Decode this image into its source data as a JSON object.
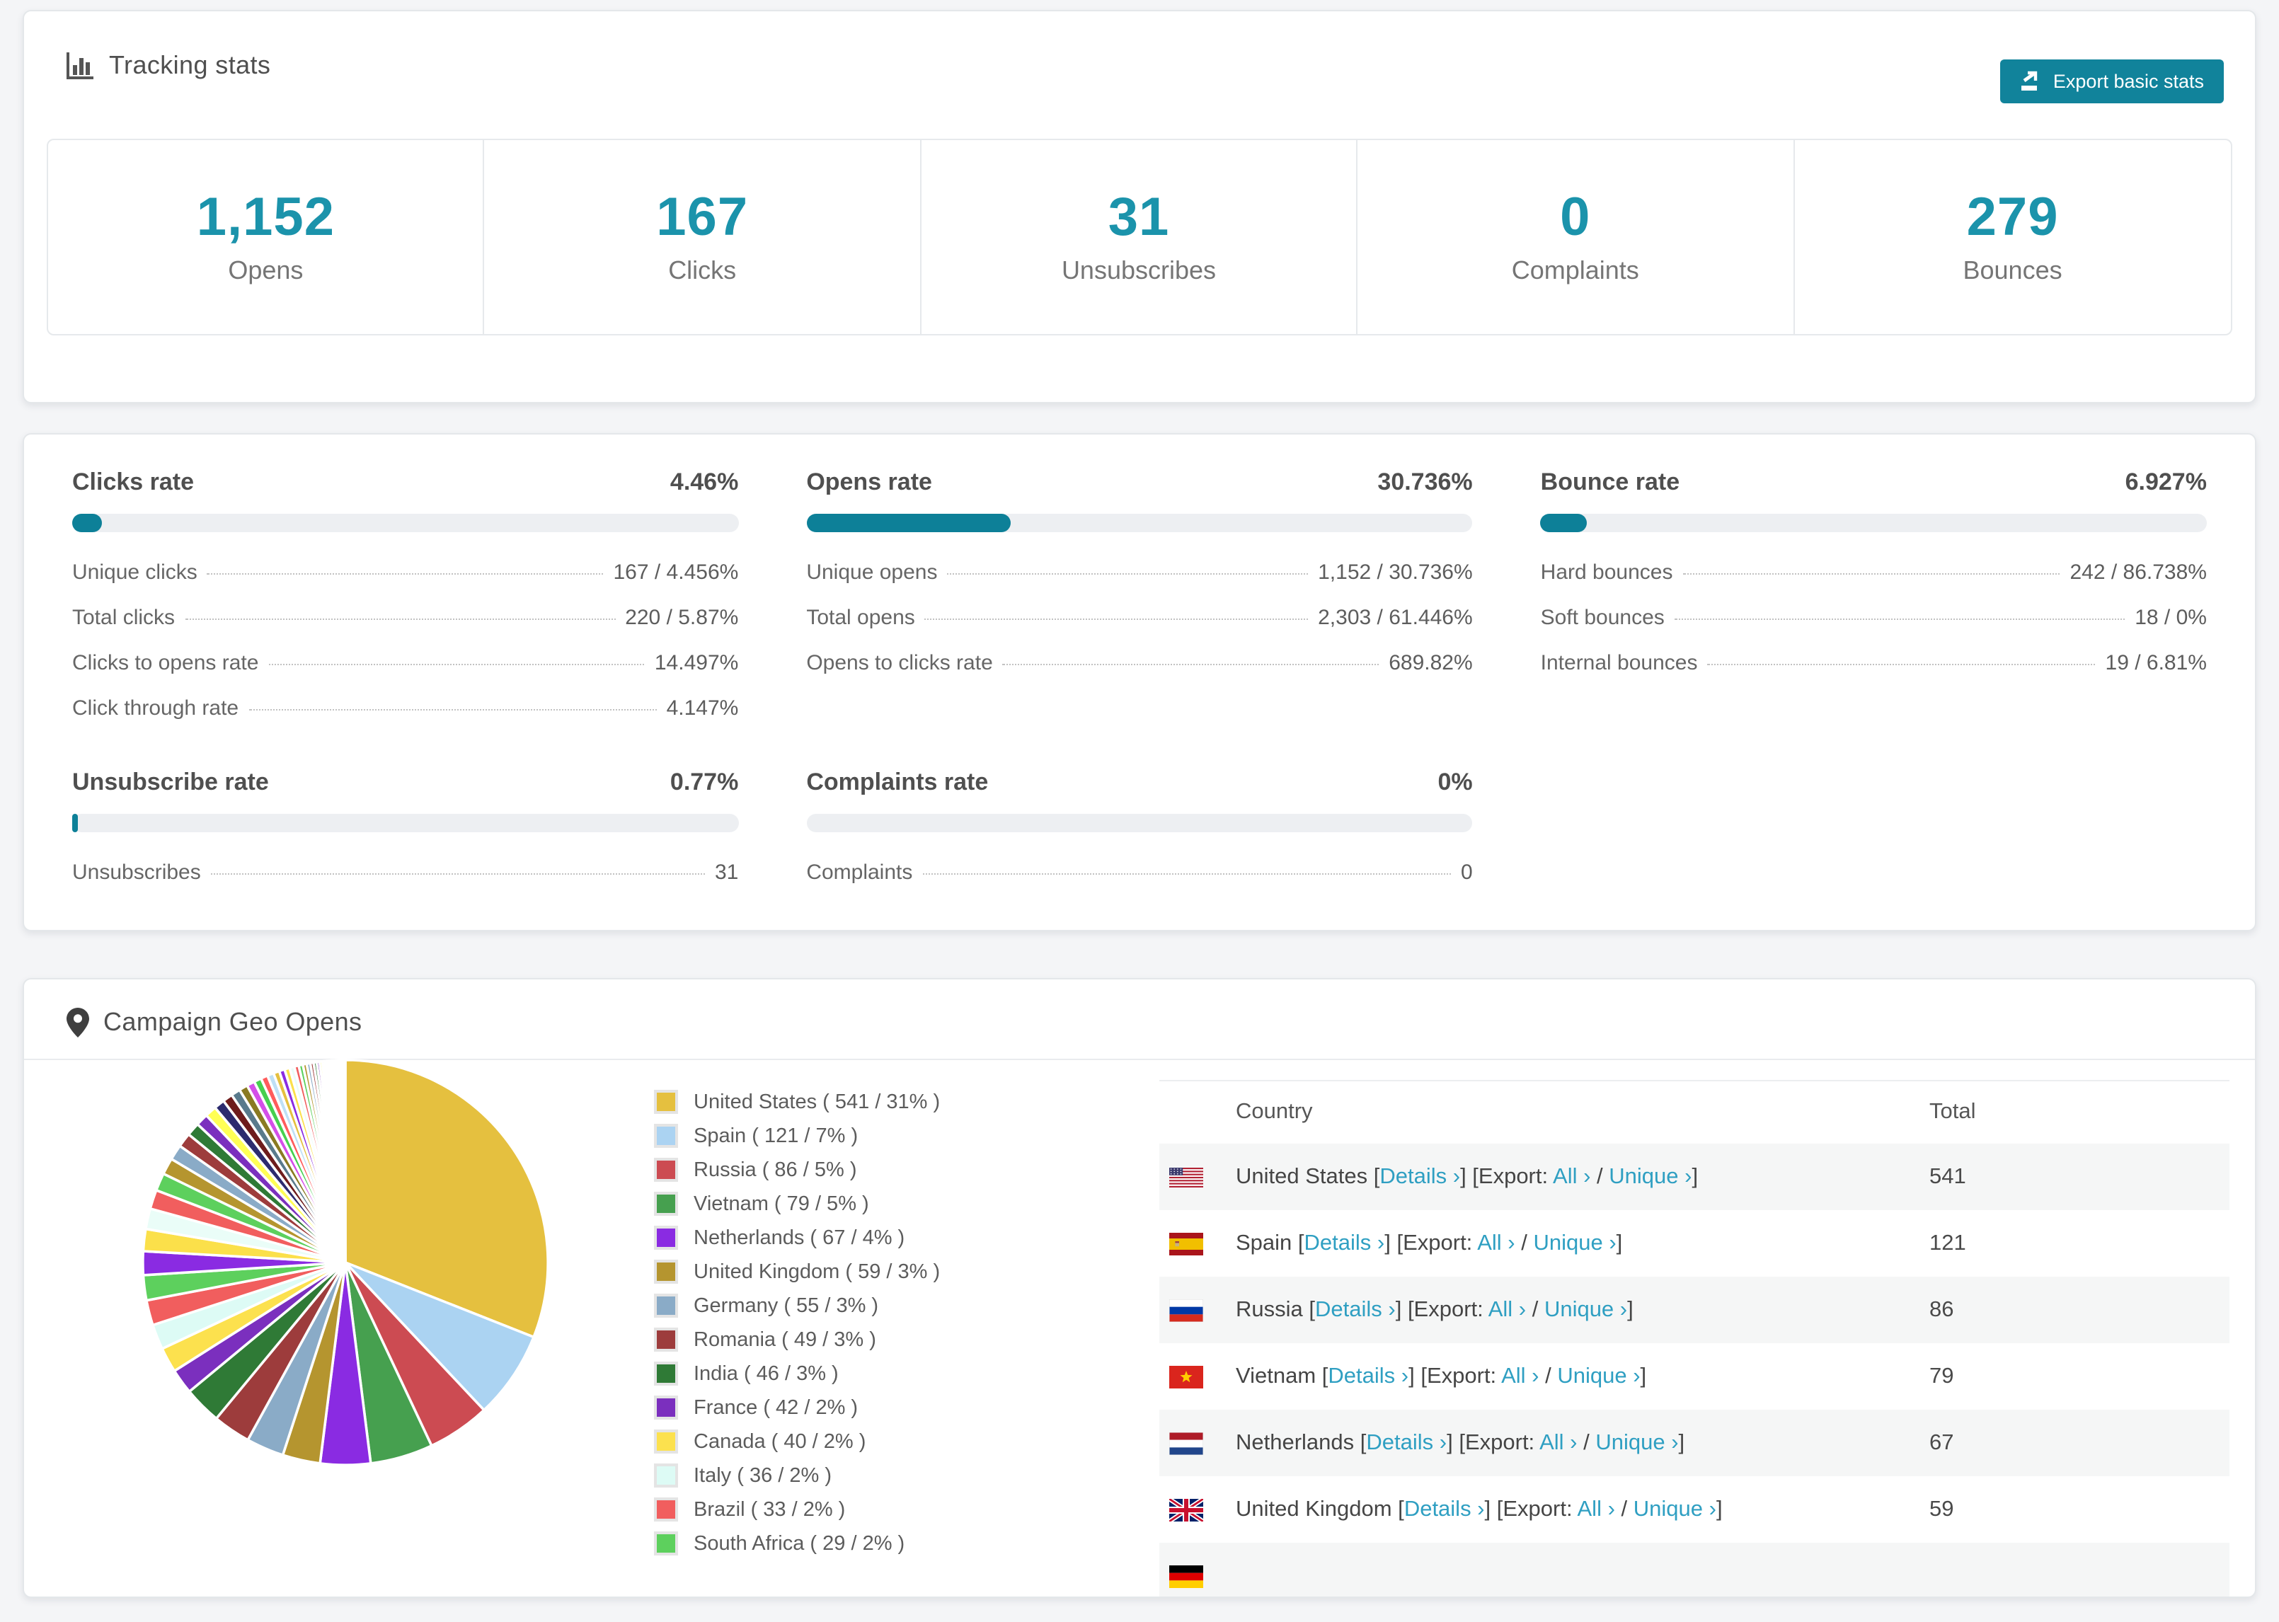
{
  "ui_colors": {
    "accent_button": "#11839b",
    "stat_number": "#1b93ab",
    "bar_fill": "#0d8098",
    "link": "#2f9fc2",
    "row_alt_bg": "#f5f6f6"
  },
  "tracking": {
    "title": "Tracking stats",
    "export_button": "Export basic stats",
    "stats": [
      {
        "value": "1,152",
        "label": "Opens"
      },
      {
        "value": "167",
        "label": "Clicks"
      },
      {
        "value": "31",
        "label": "Unsubscribes"
      },
      {
        "value": "0",
        "label": "Complaints"
      },
      {
        "value": "279",
        "label": "Bounces"
      }
    ]
  },
  "rates": {
    "sections": [
      {
        "title": "Clicks rate",
        "value": "4.46%",
        "pct": 4.46,
        "rows": [
          {
            "label": "Unique clicks",
            "value": "167 / 4.456%"
          },
          {
            "label": "Total clicks",
            "value": "220 / 5.87%"
          },
          {
            "label": "Clicks to opens rate",
            "value": "14.497%"
          },
          {
            "label": "Click through rate",
            "value": "4.147%"
          }
        ]
      },
      {
        "title": "Opens rate",
        "value": "30.736%",
        "pct": 30.736,
        "rows": [
          {
            "label": "Unique opens",
            "value": "1,152 / 30.736%"
          },
          {
            "label": "Total opens",
            "value": "2,303 / 61.446%"
          },
          {
            "label": "Opens to clicks rate",
            "value": "689.82%"
          }
        ]
      },
      {
        "title": "Bounce rate",
        "value": "6.927%",
        "pct": 6.927,
        "rows": [
          {
            "label": "Hard bounces",
            "value": "242 / 86.738%"
          },
          {
            "label": "Soft bounces",
            "value": "18 / 0%"
          },
          {
            "label": "Internal bounces",
            "value": "19 / 6.81%"
          }
        ]
      },
      {
        "title": "Unsubscribe rate",
        "value": "0.77%",
        "pct": 0.77,
        "rows": [
          {
            "label": "Unsubscribes",
            "value": "31"
          }
        ]
      },
      {
        "title": "Complaints rate",
        "value": "0%",
        "pct": 0,
        "rows": [
          {
            "label": "Complaints",
            "value": "0"
          }
        ]
      }
    ]
  },
  "geo": {
    "title": "Campaign Geo Opens",
    "table": {
      "headers": [
        "Country",
        "Total"
      ],
      "link_labels": {
        "details": "Details ›",
        "export_prefix": "Export:",
        "all": "All ›",
        "unique": "Unique ›"
      },
      "rows": [
        {
          "flag": "us",
          "country": "United States",
          "total": "541"
        },
        {
          "flag": "es",
          "country": "Spain",
          "total": "121"
        },
        {
          "flag": "ru",
          "country": "Russia",
          "total": "86"
        },
        {
          "flag": "vn",
          "country": "Vietnam",
          "total": "79"
        },
        {
          "flag": "nl",
          "country": "Netherlands",
          "total": "67"
        },
        {
          "flag": "gb",
          "country": "United Kingdom",
          "total": "59"
        },
        {
          "flag": "de",
          "country": "",
          "total": ""
        }
      ]
    }
  },
  "chart_data": {
    "type": "pie",
    "title": "Campaign Geo Opens",
    "start_angle_deg": 0,
    "direction": "clockwise",
    "legend_position": "right",
    "series": [
      {
        "name": "United States",
        "value": 541,
        "pct": 31,
        "color": "#e5c03f"
      },
      {
        "name": "Spain",
        "value": 121,
        "pct": 7,
        "color": "#abd3f2"
      },
      {
        "name": "Russia",
        "value": 86,
        "pct": 5,
        "color": "#cc4b52"
      },
      {
        "name": "Vietnam",
        "value": 79,
        "pct": 5,
        "color": "#46a04f"
      },
      {
        "name": "Netherlands",
        "value": 67,
        "pct": 4,
        "color": "#8a2be2"
      },
      {
        "name": "United Kingdom",
        "value": 59,
        "pct": 3,
        "color": "#b5952f"
      },
      {
        "name": "Germany",
        "value": 55,
        "pct": 3,
        "color": "#8aabc7"
      },
      {
        "name": "Romania",
        "value": 49,
        "pct": 3,
        "color": "#9d3c3c"
      },
      {
        "name": "India",
        "value": 46,
        "pct": 3,
        "color": "#2f7a36"
      },
      {
        "name": "France",
        "value": 42,
        "pct": 2,
        "color": "#7b2fbe"
      },
      {
        "name": "Canada",
        "value": 40,
        "pct": 2,
        "color": "#fce14e"
      },
      {
        "name": "Italy",
        "value": 36,
        "pct": 2,
        "color": "#ddfbf5"
      },
      {
        "name": "Brazil",
        "value": 33,
        "pct": 2,
        "color": "#f15e5e"
      },
      {
        "name": "South Africa",
        "value": 29,
        "pct": 2,
        "color": "#5dd05d"
      }
    ],
    "others": {
      "total_pct": 26,
      "slice_count": 45,
      "decay": 0.93,
      "palette": [
        "#8a2be2",
        "#fbe04a",
        "#eafdf8",
        "#f15e5e",
        "#5dd05d",
        "#b5952f",
        "#8aabc7",
        "#9d3c3c",
        "#2f7a36",
        "#7b2fbe",
        "#ffff55",
        "#2c2b6e",
        "#6e1c1c",
        "#597a8c",
        "#8a7a22",
        "#d44fe8",
        "#46d04f",
        "#ff5c5c",
        "#bfe0f5",
        "#e5c03f"
      ]
    }
  }
}
